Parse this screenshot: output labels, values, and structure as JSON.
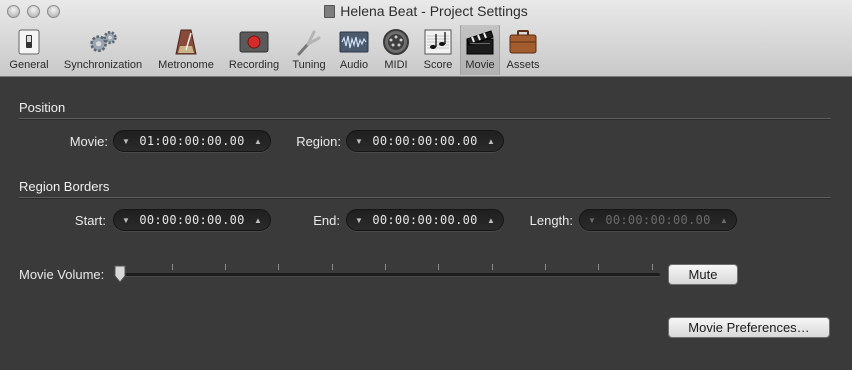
{
  "window": {
    "title": "Helena Beat - Project Settings"
  },
  "toolbar": {
    "items": [
      {
        "label": "General",
        "icon": "general-switch-icon"
      },
      {
        "label": "Synchronization",
        "icon": "gears-icon"
      },
      {
        "label": "Metronome",
        "icon": "metronome-icon"
      },
      {
        "label": "Recording",
        "icon": "record-button-icon"
      },
      {
        "label": "Tuning",
        "icon": "tuning-fork-icon"
      },
      {
        "label": "Audio",
        "icon": "waveform-icon"
      },
      {
        "label": "MIDI",
        "icon": "midi-connector-icon"
      },
      {
        "label": "Score",
        "icon": "score-notes-icon"
      },
      {
        "label": "Movie",
        "icon": "clapperboard-icon",
        "selected": true
      },
      {
        "label": "Assets",
        "icon": "briefcase-icon"
      }
    ]
  },
  "position": {
    "title": "Position",
    "movie_label": "Movie:",
    "movie_value": "01:00:00:00.00",
    "region_label": "Region:",
    "region_value": "00:00:00:00.00"
  },
  "region_borders": {
    "title": "Region Borders",
    "start_label": "Start:",
    "start_value": "00:00:00:00.00",
    "end_label": "End:",
    "end_value": "00:00:00:00.00",
    "length_label": "Length:",
    "length_value": "00:00:00:00.00"
  },
  "movie_volume": {
    "label": "Movie Volume:",
    "value": 0,
    "mute_label": "Mute"
  },
  "movie_preferences_label": "Movie Preferences…",
  "colors": {
    "background": "#3a3a3a",
    "toolbar": "#d4d4d4",
    "record_red": "#d62b2b"
  }
}
